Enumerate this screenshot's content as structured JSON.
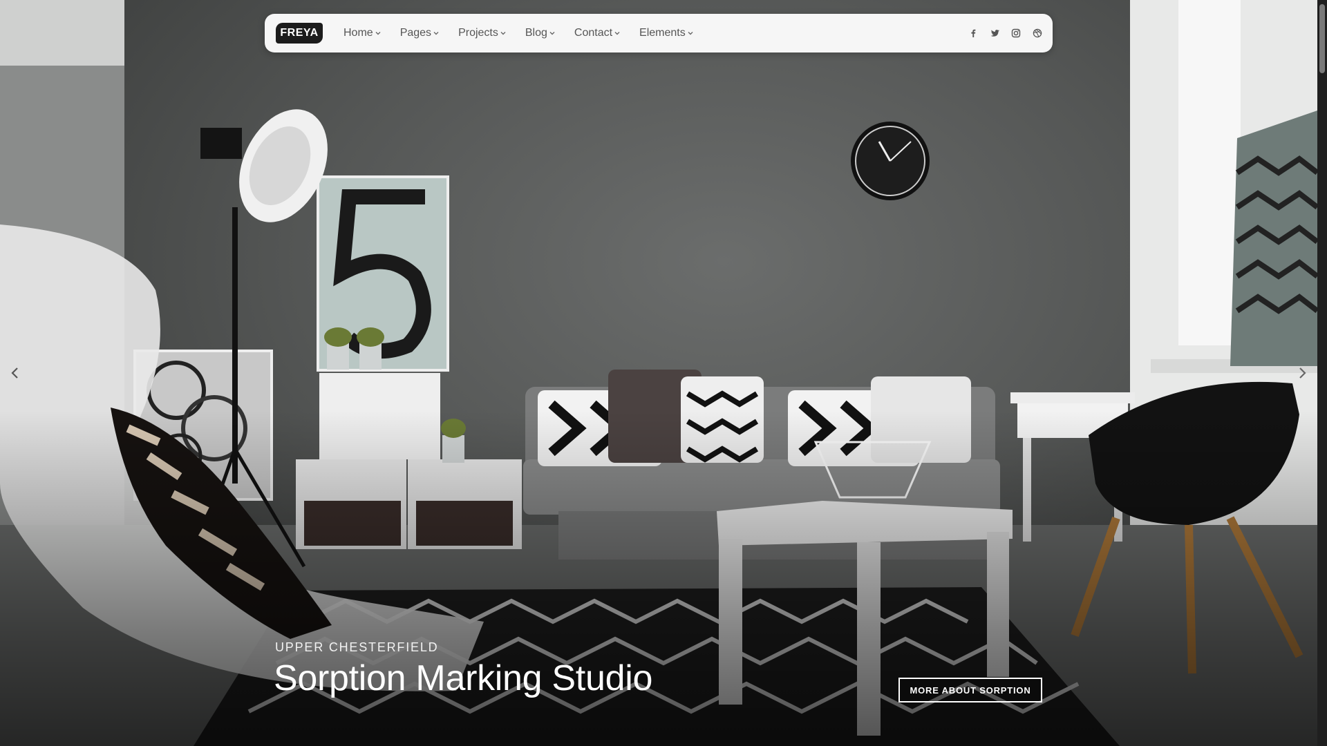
{
  "brand": {
    "logo_text": "FREYA"
  },
  "nav": {
    "items": [
      {
        "label": "Home"
      },
      {
        "label": "Pages"
      },
      {
        "label": "Projects"
      },
      {
        "label": "Blog"
      },
      {
        "label": "Contact"
      },
      {
        "label": "Elements"
      }
    ],
    "social_icons": [
      "facebook-icon",
      "twitter-icon",
      "instagram-icon",
      "dribbble-icon"
    ]
  },
  "slide": {
    "subtitle": "UPPER CHESTERFIELD",
    "title": "Sorption Marking Studio",
    "cta_label": "MORE ABOUT SORPTION"
  },
  "colors": {
    "nav_bg": "#f6f6f6",
    "logo_bg": "#1c1c1c",
    "text_light": "#ffffff"
  }
}
